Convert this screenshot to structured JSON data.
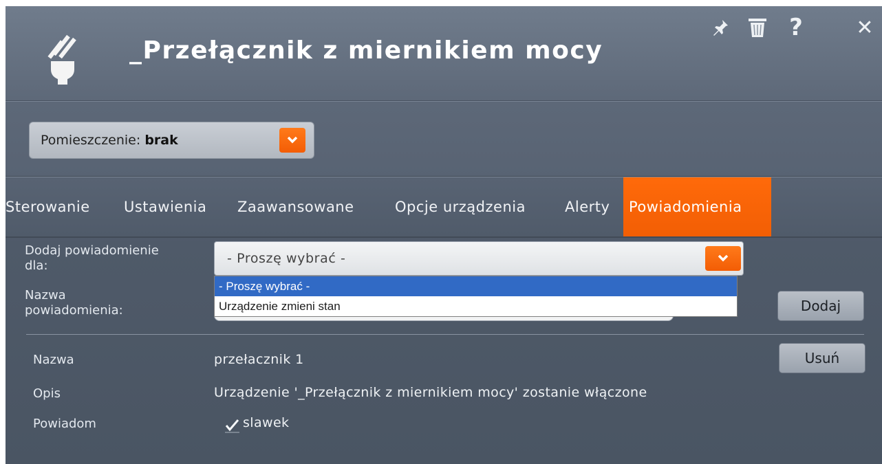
{
  "header": {
    "title": "_Przełącznik z miernikiem mocy",
    "icons": [
      "plug-icon",
      "pin-icon",
      "trash-icon",
      "help-icon",
      "close-icon"
    ],
    "help_label": "?",
    "close_label": "✕"
  },
  "room": {
    "label": "Pomieszczenie: ",
    "value": "brak"
  },
  "tabs": [
    {
      "label": "Sterowanie"
    },
    {
      "label": "Ustawienia"
    },
    {
      "label": "Zaawansowane"
    },
    {
      "label": "Opcje urządzenia"
    },
    {
      "label": "Alerty"
    },
    {
      "label": "Powiadomienia",
      "active": true
    }
  ],
  "form": {
    "add_for_label_line1": "Dodaj powiadomienie",
    "add_for_label_line2": "dla:",
    "select_value": "- Proszę wybrać -",
    "options": [
      "- Proszę wybrać -",
      "Urządzenie zmieni stan"
    ],
    "name_label_line1": "Nazwa",
    "name_label_line2": "powiadomienia:",
    "name_value": "",
    "add_button": "Dodaj"
  },
  "notification": {
    "name_label": "Nazwa",
    "name_value": "przełacznik 1",
    "desc_label": "Opis",
    "desc_value": "Urządzenie '_Przełącznik z miernikiem mocy' zostanie włączone",
    "notify_label": "Powiadom",
    "notify_user": "slawek",
    "notify_checked": true,
    "remove_button": "Usuń"
  },
  "colors": {
    "accent": "#f5640a",
    "panel": "#5b6676",
    "selection": "#316ac5"
  }
}
